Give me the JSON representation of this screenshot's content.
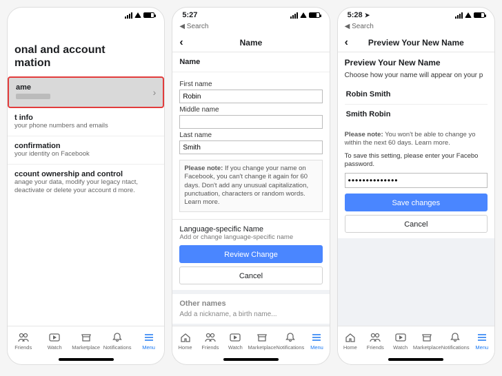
{
  "status": {
    "time2": "5:27",
    "time3": "5:28",
    "arrow": "➤"
  },
  "back_search": "◀ Search",
  "phone1": {
    "title_line1": "onal and account",
    "title_line2": "mation",
    "row_name": "ame",
    "row_contact_t": "t info",
    "row_contact_s": "your phone numbers and emails",
    "row_identity_t": "confirmation",
    "row_identity_s": "your identity on Facebook",
    "row_own_t": "ccount ownership and control",
    "row_own_s": "anage your data, modify your legacy ntact, deactivate or delete your account d more."
  },
  "phone2": {
    "header": "Name",
    "section": "Name",
    "first_label": "First name",
    "first_val": "Robin",
    "middle_label": "Middle name",
    "middle_val": "",
    "last_label": "Last name",
    "last_val": "Smith",
    "note_bold": "Please note:",
    "note": "If you change your name on Facebook, you can't change it again for 60 days. Don't add any unusual capitalization, punctuation, characters or random words. Learn more.",
    "lang_t": "Language-specific Name",
    "lang_s": "Add or change language-specific name",
    "review": "Review Change",
    "cancel": "Cancel",
    "other_t": "Other names",
    "other_s": "Add a nickname, a birth name..."
  },
  "phone3": {
    "header": "Preview Your New Name",
    "head": "Preview Your New Name",
    "sub": "Choose how your name will appear on your p",
    "opt1": "Robin Smith",
    "opt2": "Smith Robin",
    "note_b": "Please note:",
    "note": "You won't be able to change yo within the next 60 days. Learn more.",
    "save_prompt": "To save this setting, please enter your Facebo password.",
    "pw": "••••••••••••••",
    "save": "Save changes",
    "cancel": "Cancel"
  },
  "tabs": {
    "home": "Home",
    "friends": "Friends",
    "watch": "Watch",
    "market": "Marketplace",
    "notif": "Notifications",
    "menu": "Menu"
  }
}
